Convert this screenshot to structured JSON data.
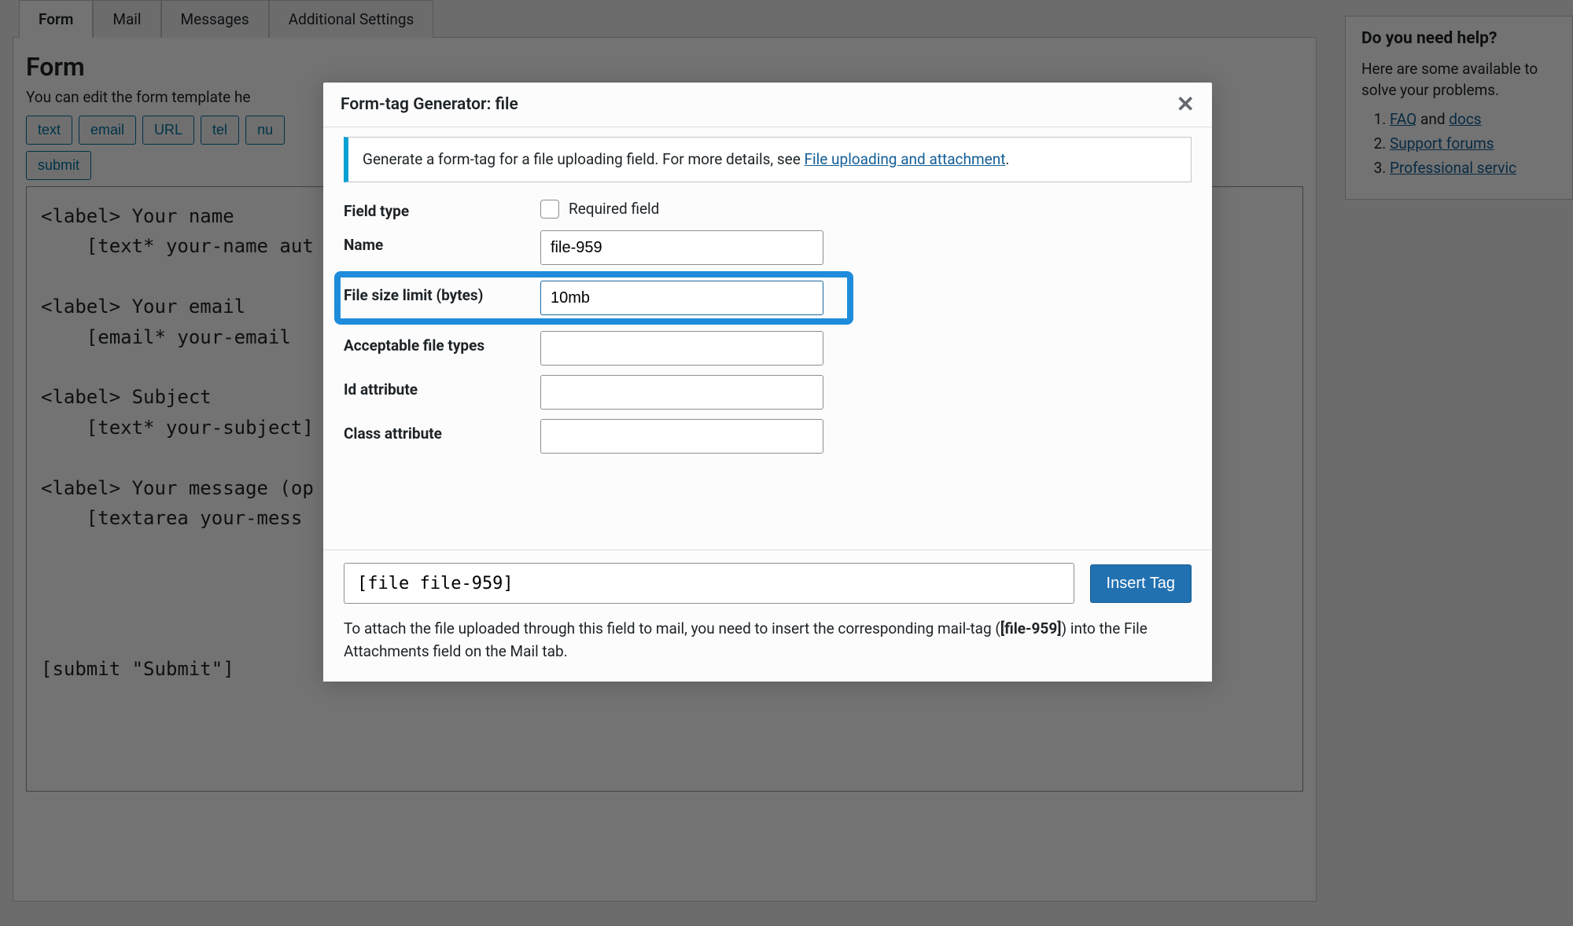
{
  "tabs": [
    {
      "label": "Form",
      "active": true
    },
    {
      "label": "Mail",
      "active": false
    },
    {
      "label": "Messages",
      "active": false
    },
    {
      "label": "Additional Settings",
      "active": false
    }
  ],
  "form_panel": {
    "title": "Form",
    "hint": "You can edit the form template he",
    "tagbuttons": [
      "text",
      "email",
      "URL",
      "tel",
      "nu",
      "submit"
    ],
    "template": "<label> Your name\n    [text* your-name aut\n\n<label> Your email\n    [email* your-email \n\n<label> Subject\n    [text* your-subject]\n\n<label> Your message (op\n    [textarea your-mess\n\n\n\n\n[submit \"Submit\"]"
  },
  "sidebar": {
    "title": "Do you need help?",
    "intro": "Here are some available to solve your problems.",
    "items": [
      {
        "pre": "",
        "link": "FAQ",
        "post": " and ",
        "link2": "docs"
      },
      {
        "pre": "",
        "link": "Support forums",
        "post": "",
        "link2": ""
      },
      {
        "pre": "",
        "link": "Professional servic",
        "post": "",
        "link2": ""
      }
    ]
  },
  "modal": {
    "title": "Form-tag Generator: file",
    "notice_pre": "Generate a form-tag for a file uploading field. For more details, see ",
    "notice_link": "File uploading and attachment",
    "notice_post": ".",
    "fields": {
      "field_type_label": "Field type",
      "required_label": "Required field",
      "name_label": "Name",
      "name_value": "file-959",
      "size_label": "File size limit (bytes)",
      "size_value": "10mb",
      "types_label": "Acceptable file types",
      "types_value": "",
      "id_label": "Id attribute",
      "id_value": "",
      "class_label": "Class attribute",
      "class_value": ""
    },
    "tag_output": "[file file-959]",
    "insert_label": "Insert Tag",
    "footnote_pre": "To attach the file uploaded through this field to mail, you need to insert the corresponding mail-tag (",
    "footnote_tag": "[file-959]",
    "footnote_post": ") into the File Attachments field on the Mail tab."
  }
}
